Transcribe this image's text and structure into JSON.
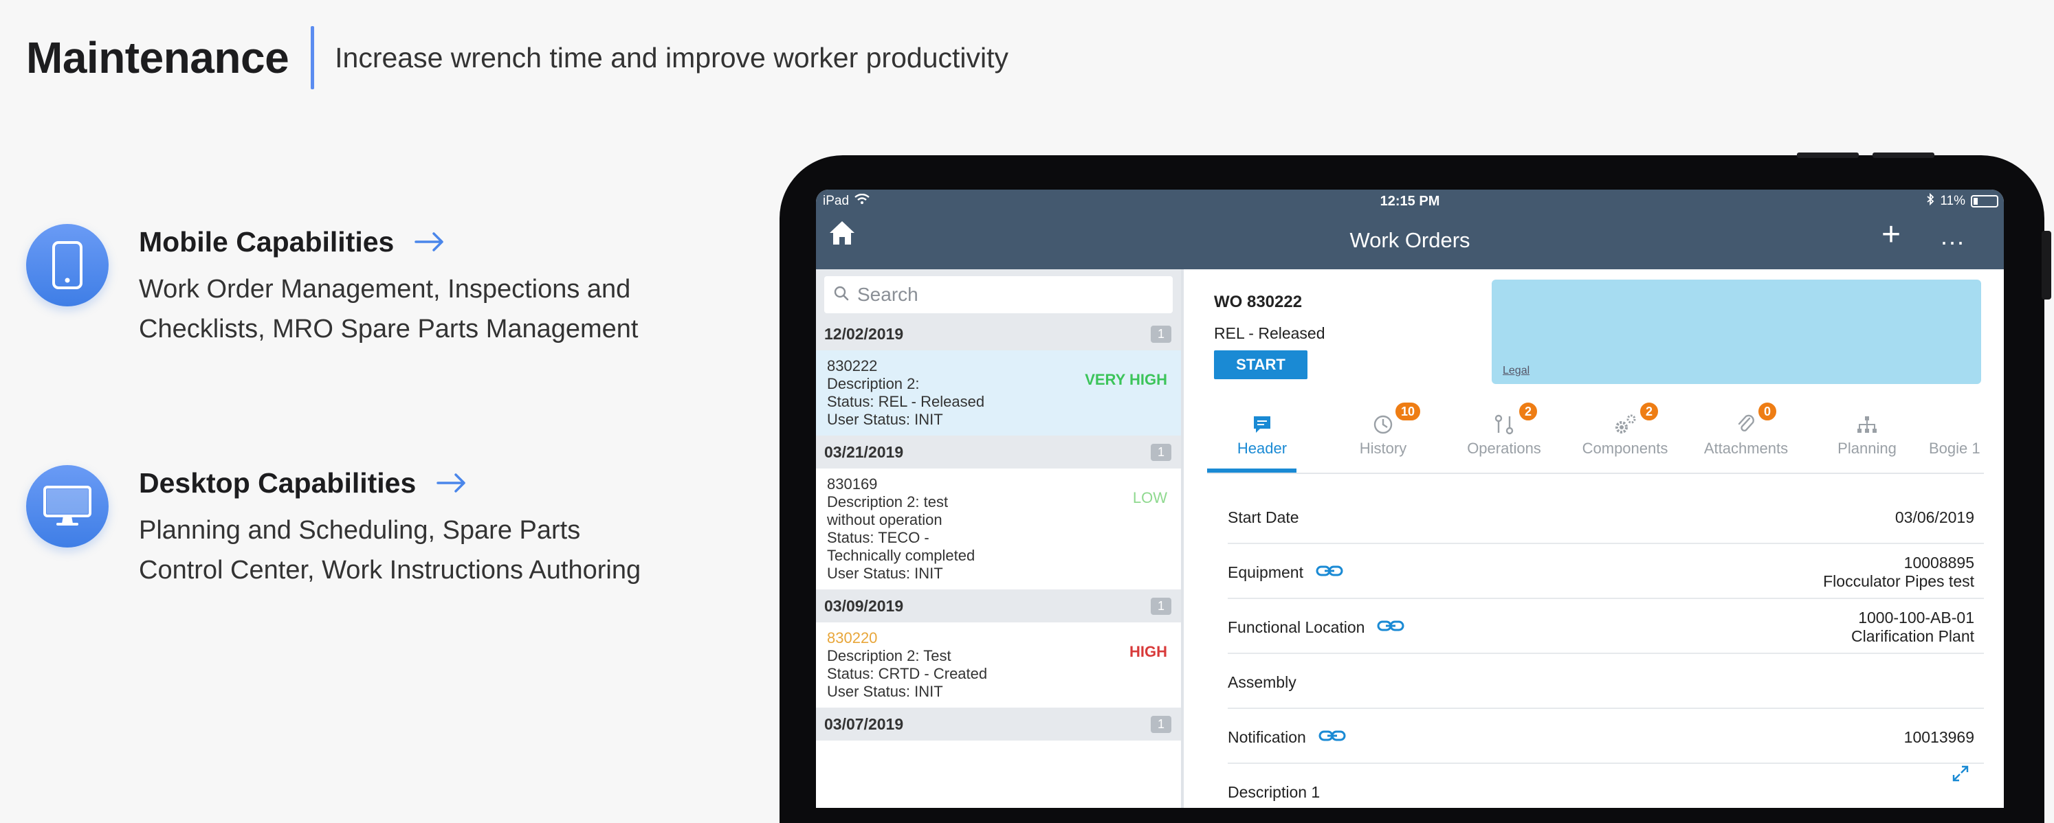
{
  "header": {
    "title": "Maintenance",
    "subtitle": "Increase wrench time and improve worker productivity"
  },
  "capabilities": {
    "mobile": {
      "title": "Mobile Capabilities",
      "description": "Work Order Management, Inspections and Checklists, MRO Spare Parts Management",
      "icon": "smartphone-icon"
    },
    "desktop": {
      "title": "Desktop Capabilities",
      "description": "Planning and Scheduling, Spare Parts Control Center, Work Instructions Authoring",
      "icon": "monitor-icon"
    }
  },
  "colors": {
    "accent_blue": "#4a86ea",
    "nav_bar": "#44596f",
    "tab_active": "#1a8ad4",
    "badge_orange": "#ee7d14",
    "priority_very_high": "#3cc45a",
    "priority_high": "#d83a3a"
  },
  "tablet": {
    "status_bar": {
      "device": "iPad",
      "time": "12:15 PM",
      "battery": "11%"
    },
    "nav": {
      "title": "Work Orders",
      "add_label": "+",
      "more_label": "..."
    },
    "list": {
      "search_placeholder": "Search",
      "groups": [
        {
          "date": "12/02/2019",
          "count": "1",
          "item": {
            "number": "830222",
            "lines": [
              "Description 2:",
              "Status: REL - Released",
              "User Status: INIT"
            ],
            "priority": "VERY HIGH"
          }
        },
        {
          "date": "03/21/2019",
          "count": "1",
          "item": {
            "number": "830169",
            "lines": [
              "Description 2: test",
              "without operation",
              "Status: TECO -",
              "Technically completed",
              "User Status: INIT"
            ],
            "priority": "LOW"
          }
        },
        {
          "date": "03/09/2019",
          "count": "1",
          "item": {
            "number": "830220",
            "lines": [
              "Description 2: Test",
              "Status: CRTD - Created",
              "User Status: INIT"
            ],
            "priority": "HIGH"
          }
        },
        {
          "date": "03/07/2019",
          "count": "1"
        }
      ]
    },
    "detail": {
      "wo_id": "WO 830222",
      "status": "REL - Released",
      "start_label": "START",
      "map_legal": "Legal",
      "tabs": [
        {
          "label": "Header",
          "badge": ""
        },
        {
          "label": "History",
          "badge": "10"
        },
        {
          "label": "Operations",
          "badge": "2"
        },
        {
          "label": "Components",
          "badge": "2"
        },
        {
          "label": "Attachments",
          "badge": "0"
        },
        {
          "label": "Planning",
          "badge": ""
        },
        {
          "label": "Bogie 1",
          "badge": ""
        }
      ],
      "fields": [
        {
          "label": "Start Date",
          "value": "03/06/2019",
          "value2": ""
        },
        {
          "label": "Equipment",
          "value": "10008895",
          "value2": "Flocculator Pipes test"
        },
        {
          "label": "Functional Location",
          "value": "1000-100-AB-01",
          "value2": "Clarification Plant"
        },
        {
          "label": "Assembly",
          "value": "",
          "value2": ""
        },
        {
          "label": "Notification",
          "value": "10013969",
          "value2": ""
        },
        {
          "label": "Description 1",
          "value": "",
          "value2": ""
        }
      ]
    }
  }
}
